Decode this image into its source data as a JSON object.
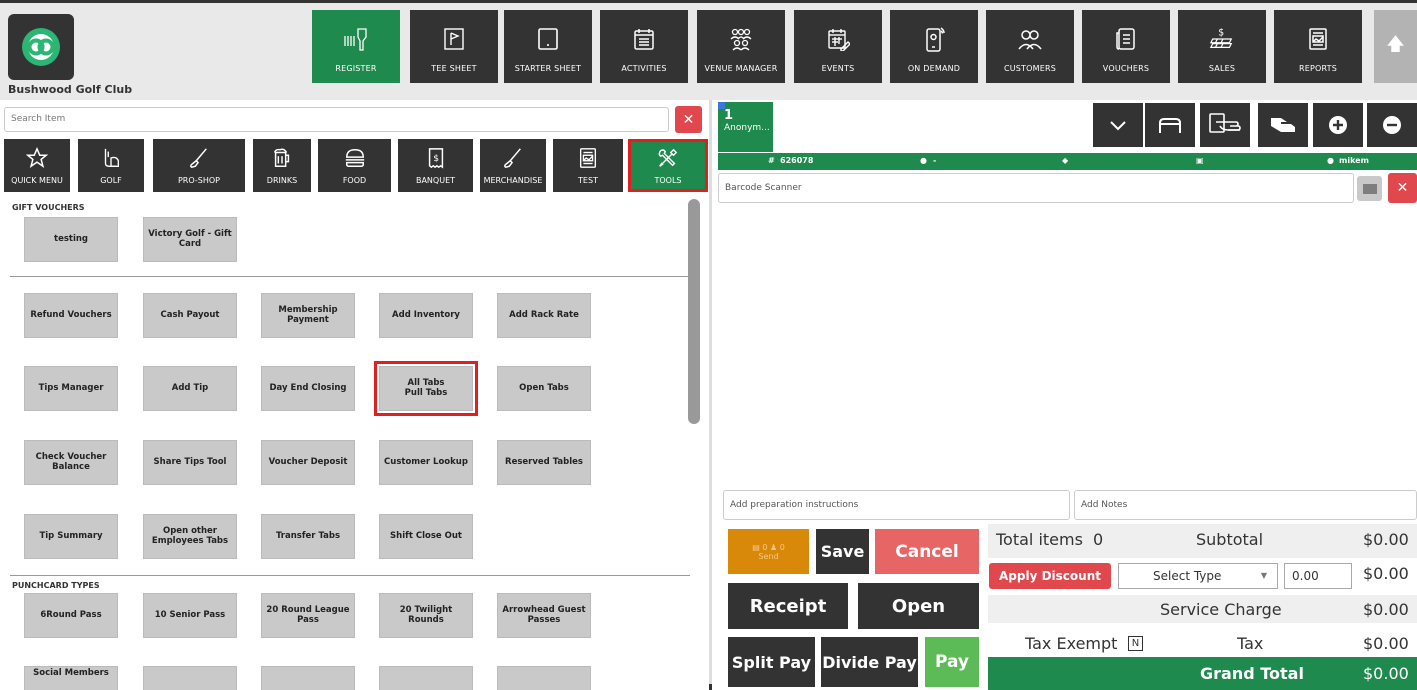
{
  "header": {
    "club_name": "Bushwood Golf Club",
    "nav": [
      {
        "label": "REGISTER",
        "icon": "barcode-scanner-icon",
        "active": true
      },
      {
        "label": "TEE SHEET",
        "icon": "tee-sheet-icon"
      },
      {
        "label": "STARTER SHEET",
        "icon": "tablet-icon"
      },
      {
        "label": "ACTIVITIES",
        "icon": "calendar-list-icon"
      },
      {
        "label": "VENUE MANAGER",
        "icon": "venue-people-icon"
      },
      {
        "label": "EVENTS",
        "icon": "calendar-edit-icon"
      },
      {
        "label": "ON DEMAND",
        "icon": "mobile-icon"
      },
      {
        "label": "CUSTOMERS",
        "icon": "customers-icon"
      },
      {
        "label": "VOUCHERS",
        "icon": "voucher-icon"
      },
      {
        "label": "SALES",
        "icon": "sales-icon"
      },
      {
        "label": "REPORTS",
        "icon": "reports-icon"
      }
    ]
  },
  "search": {
    "placeholder": "Search Item"
  },
  "categories": [
    {
      "label": "QUICK MENU",
      "icon": "star-icon"
    },
    {
      "label": "GOLF",
      "icon": "golf-bag-icon"
    },
    {
      "label": "PRO-SHOP",
      "icon": "golf-club-icon"
    },
    {
      "label": "DRINKS",
      "icon": "beer-mug-icon"
    },
    {
      "label": "FOOD",
      "icon": "burger-icon"
    },
    {
      "label": "BANQUET",
      "icon": "receipt-icon"
    },
    {
      "label": "MERCHANDISE",
      "icon": "golf-club-icon"
    },
    {
      "label": "TEST",
      "icon": "report-icon"
    },
    {
      "label": "TOOLS",
      "icon": "tools-icon",
      "active": true
    }
  ],
  "sections": {
    "gift_vouchers": "GIFT VOUCHERS",
    "punchcard_types": "PUNCHCARD TYPES"
  },
  "gift_items": [
    "testing",
    "Victory Golf - Gift Card"
  ],
  "tool_items": [
    "Refund Vouchers",
    "Cash Payout",
    "Membership Payment",
    "Add Inventory",
    "Add Rack Rate",
    "Tips Manager",
    "Add Tip",
    "Day End Closing",
    "All Tabs\nPull Tabs",
    "Open Tabs",
    "Check Voucher Balance",
    "Share Tips Tool",
    "Voucher Deposit",
    "Customer Lookup",
    "Reserved Tables",
    "Tip Summary",
    "Open other Employees Tabs",
    "Transfer Tabs",
    "Shift Close Out"
  ],
  "punch_items": [
    "6Round Pass",
    "10 Senior Pass",
    "20 Round League Pass",
    "20 Twilight Rounds",
    "Arrowhead Guest Passes",
    "Social Members",
    "",
    "",
    "",
    ""
  ],
  "tab": {
    "number": "1",
    "name": "Anonym..."
  },
  "info_bar": {
    "ticket": "626078",
    "customer": "-",
    "user": "mikem"
  },
  "barcode": {
    "placeholder": "Barcode Scanner"
  },
  "prep": {
    "placeholder": "Add preparation instructions"
  },
  "notes": {
    "placeholder": "Add Notes"
  },
  "send": {
    "guests": "0",
    "seats": "0",
    "label": "Send"
  },
  "buttons": {
    "save": "Save",
    "cancel": "Cancel",
    "receipt": "Receipt",
    "open": "Open",
    "split_pay": "Split Pay",
    "divide_pay": "Divide Pay",
    "pay": "Pay"
  },
  "totals": {
    "total_items_label": "Total items",
    "total_items": "0",
    "subtotal_label": "Subtotal",
    "subtotal": "$0.00",
    "apply_discount": "Apply Discount",
    "select_type": "Select Type",
    "discount_value": "0.00",
    "discount": "$0.00",
    "service_charge_label": "Service Charge",
    "service_charge": "$0.00",
    "tax_exempt_label": "Tax Exempt",
    "tax_exempt_flag": "N",
    "tax_label": "Tax",
    "tax": "$0.00",
    "grand_total_label": "Grand Total",
    "grand_total": "$0.00"
  },
  "colors": {
    "primary_green": "#1e8a4d",
    "dark": "#333333",
    "danger": "#e0484e",
    "send_orange": "#d9890a",
    "highlight": "#e02020"
  }
}
